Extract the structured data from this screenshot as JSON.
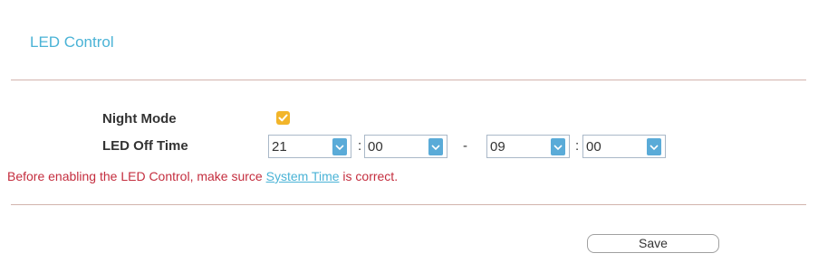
{
  "section": {
    "title": "LED Control"
  },
  "night_mode": {
    "label": "Night Mode",
    "checked": true,
    "checkbox_color": "#f2b52a"
  },
  "led_off_time": {
    "label": "LED Off Time",
    "start_hour": "21",
    "start_minute": "00",
    "end_hour": "09",
    "end_minute": "00",
    "time_separator": ":",
    "range_separator": "-"
  },
  "notice": {
    "text_before": "Before enabling the LED Control, make surce ",
    "link_text": "System Time",
    "text_after": " is correct.",
    "color": "#c42d3e"
  },
  "actions": {
    "save_label": "Save"
  },
  "colors": {
    "accent": "#4ab3d6",
    "divider": "#d2b4ad",
    "dropdown_button": "#5aabd8"
  }
}
